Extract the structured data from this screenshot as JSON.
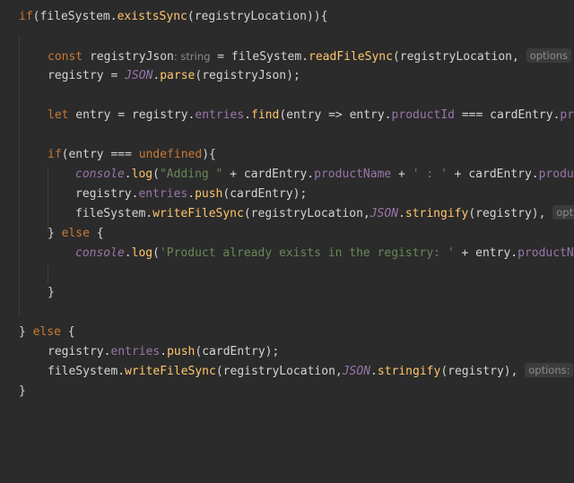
{
  "code": {
    "l1": {
      "kw_if": "if",
      "p1": "(",
      "id1": "fileSystem",
      ".": ".",
      "fn": "existsSync",
      "p2": "(",
      "id2": "registryLocation",
      "p3": ")){"
    },
    "l2": {
      "kw": "const",
      "id": " registryJson",
      "hint": ": string",
      "rest": " = fileSystem.",
      "fn": "readFileSync",
      "args": "(registryLocation,",
      "hint2": "options"
    },
    "l3": {
      "id": "registry = ",
      "obj": "JSON",
      "dot": ".",
      "fn": "parse",
      "args": "(registryJson);"
    },
    "l4": {
      "kw": "let",
      "rest": " entry = registry.",
      "prop": "entries",
      "dot": ".",
      "fn": "find",
      "args": "(entry => entry.",
      "prop2": "productId",
      "rest2": " === cardEntry.",
      "prop3": "pro"
    },
    "l5": {
      "kw": "if",
      "rest": "(entry === ",
      "kw2": "undefined",
      "rest2": "){"
    },
    "l6": {
      "obj": "console",
      "dot": ".",
      "fn": "log",
      "p": "(",
      "str": "\"Adding \"",
      "rest": " + cardEntry.",
      "prop": "productName",
      "rest2": " + ",
      "str2": "' : '",
      "rest3": " + cardEntry.",
      "prop2": "produc"
    },
    "l7": {
      "rest": "registry.",
      "prop": "entries",
      "dot": ".",
      "fn": "push",
      "args": "(cardEntry);"
    },
    "l8": {
      "rest": "fileSystem.",
      "fn": "writeFileSync",
      "args": "(registryLocation,",
      "obj": "JSON",
      "dot": ".",
      "fn2": "stringify",
      "args2": "(registry),",
      "hint": "optio"
    },
    "l9": {
      "brace": "} ",
      "kw": "else",
      "rest": " {"
    },
    "l10": {
      "obj": "console",
      "dot": ".",
      "fn": "log",
      "p": "(",
      "str": "'Product already exists in the registry: '",
      "rest": " + entry.",
      "prop": "productNa"
    },
    "l11": {
      "brace": "}"
    },
    "l12": {
      "brace": "} ",
      "kw": "else",
      "rest": " {"
    },
    "l13": {
      "rest": "registry.",
      "prop": "entries",
      "dot": ".",
      "fn": "push",
      "args": "(cardEntry);"
    },
    "l14": {
      "rest": "fileSystem.",
      "fn": "writeFileSync",
      "args": "(registryLocation,",
      "obj": "JSON",
      "dot": ".",
      "fn2": "stringify",
      "args2": "(registry),",
      "hint": "options:",
      "tail": " {"
    },
    "l15": {
      "brace": "}"
    }
  },
  "colors": {
    "background": "#2b2b2b",
    "keyword": "#cc7832",
    "function": "#ffc66d",
    "property": "#9876aa",
    "string": "#6a8759"
  }
}
